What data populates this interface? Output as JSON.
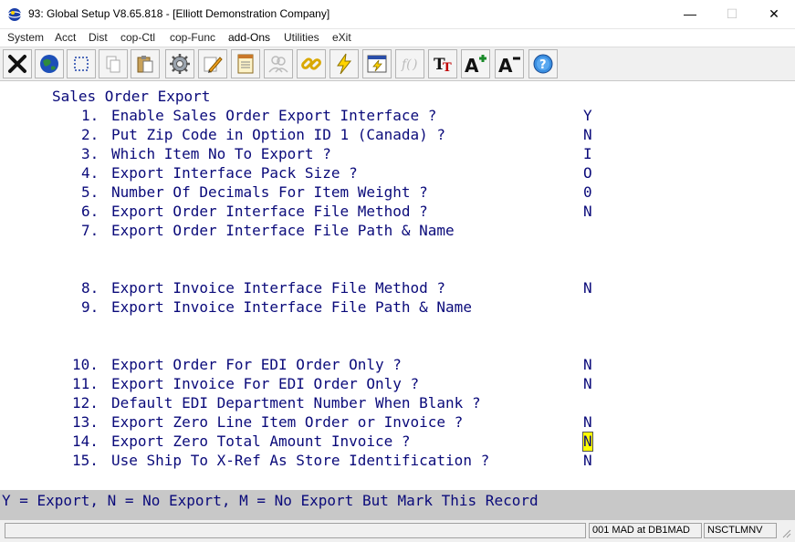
{
  "window": {
    "title": "93: Global Setup V8.65.818 - [Elliott Demonstration Company]",
    "minimize": "—",
    "maximize": "☐",
    "close": "✕"
  },
  "menu": [
    "System",
    "Acct",
    "Dist",
    "cop-Ctl",
    "cop-Func",
    "add-Ons",
    "Utilities",
    "eXit"
  ],
  "toolbar": {
    "font_button": "TT",
    "grow_font_button": "A",
    "shrink_font_button": "A"
  },
  "screen": {
    "heading": "Sales Order Export",
    "questions": [
      {
        "num": "1.",
        "text": "Enable Sales Order Export Interface ?",
        "answer": "Y"
      },
      {
        "num": "2.",
        "text": "Put Zip Code in Option ID 1 (Canada) ?",
        "answer": "N"
      },
      {
        "num": "3.",
        "text": "Which Item No To Export ?",
        "answer": "I"
      },
      {
        "num": "4.",
        "text": "Export Interface Pack Size ?",
        "answer": "O"
      },
      {
        "num": "5.",
        "text": "Number Of Decimals For Item Weight ?",
        "answer": "0"
      },
      {
        "num": "6.",
        "text": "Export Order Interface File Method ?",
        "answer": "N"
      },
      {
        "num": "7.",
        "text": "Export Order Interface File Path & Name",
        "answer": ""
      },
      {
        "num": "8.",
        "text": "Export Invoice Interface File Method ?",
        "answer": "N"
      },
      {
        "num": "9.",
        "text": "Export Invoice Interface File Path & Name",
        "answer": ""
      },
      {
        "num": "10.",
        "text": "Export Order For EDI Order Only ?",
        "answer": "N"
      },
      {
        "num": "11.",
        "text": "Export Invoice For EDI Order Only ?",
        "answer": "N"
      },
      {
        "num": "12.",
        "text": "Default EDI Department Number When Blank ?",
        "answer": ""
      },
      {
        "num": "13.",
        "text": "Export Zero Line Item Order or Invoice ?",
        "answer": "N"
      },
      {
        "num": "14.",
        "text": "Export Zero Total Amount Invoice ?",
        "answer": "N"
      },
      {
        "num": "15.",
        "text": "Use Ship To X-Ref As Store Identification ?",
        "answer": "N"
      }
    ],
    "hint": "Y = Export, N = No Export, M = No Export But Mark This Record"
  },
  "status": {
    "left": "",
    "connection": "001 MAD at DB1MAD",
    "program": "NSCTLMNV"
  },
  "colors": {
    "screen_text": "#0a0a7a",
    "hint_background": "#c8c8c8",
    "field_highlight": "#ffff00"
  }
}
